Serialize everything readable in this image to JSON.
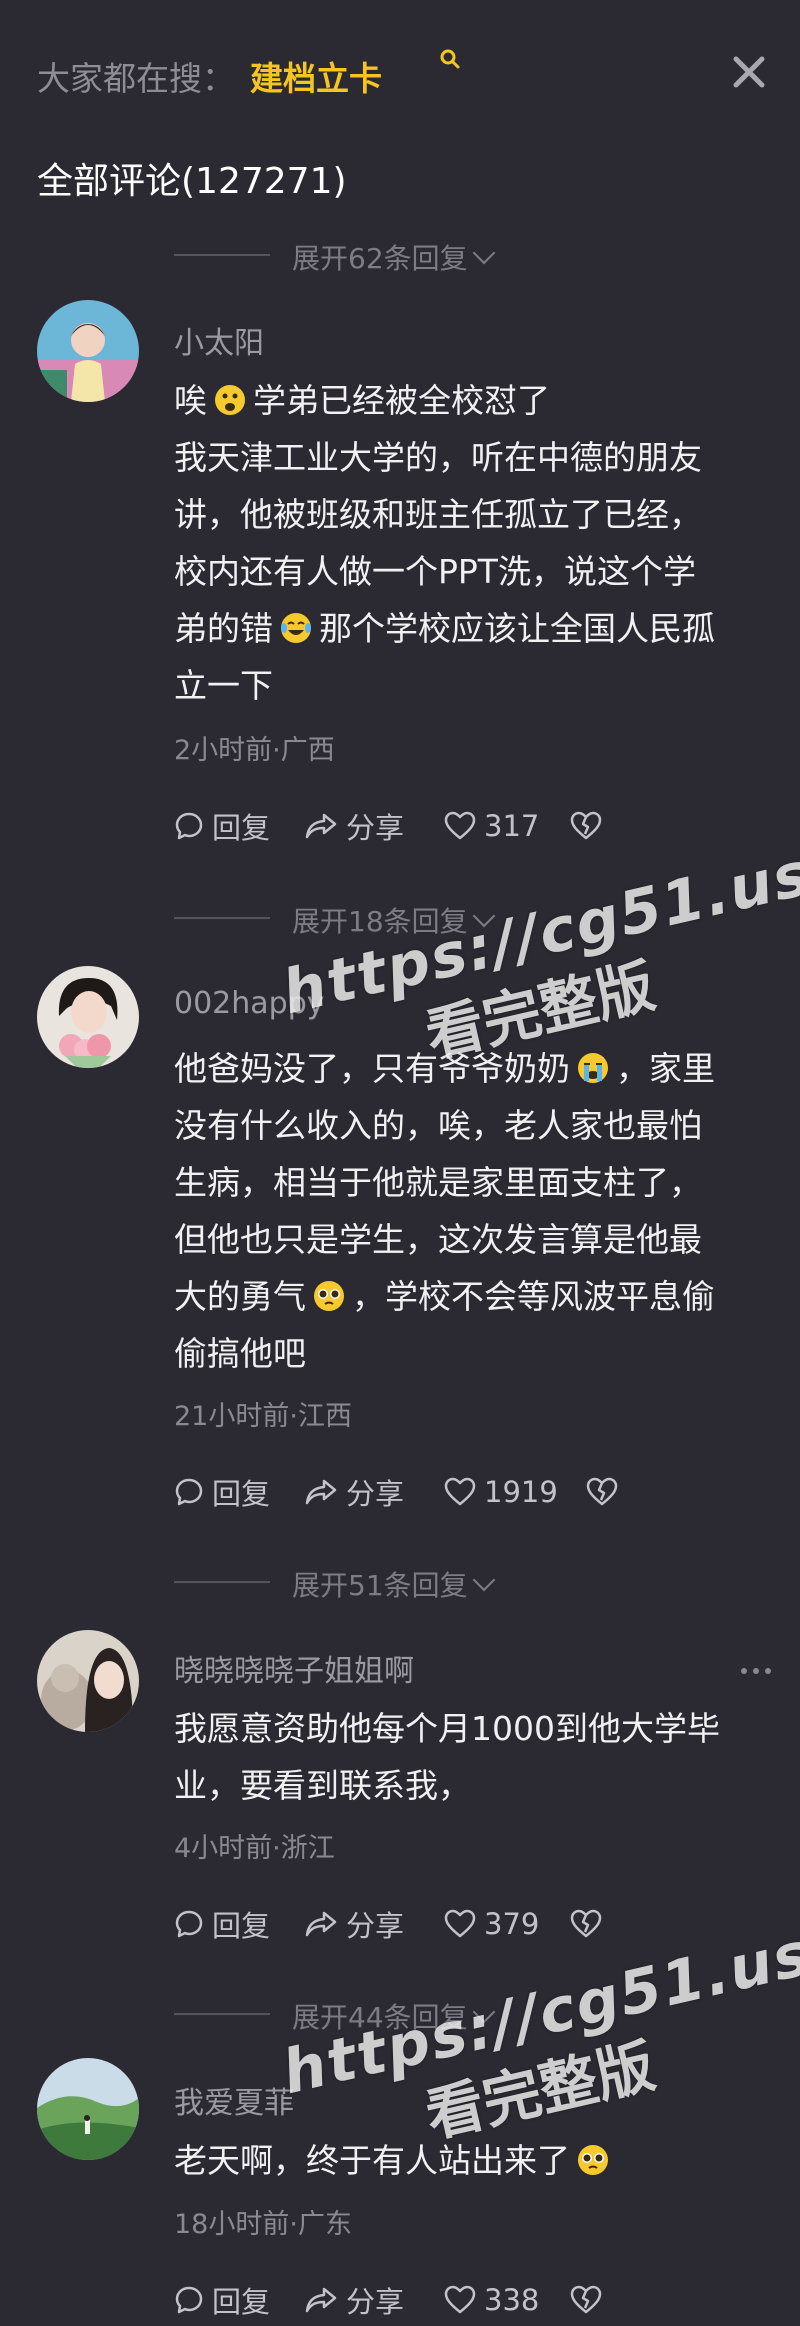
{
  "search": {
    "prefix": "大家都在搜：",
    "term": "建档立卡"
  },
  "comments_header": {
    "title": "全部评论(127271)"
  },
  "expand_labels": [
    "展开62条回复",
    "展开18条回复",
    "展开51条回复",
    "展开44条回复"
  ],
  "comments": [
    {
      "username": "小太阳",
      "lines": [
        {
          "text": "唉",
          "emoji": "scared-face-emoji",
          "after": "学弟已经被全校怼了"
        },
        {
          "text": "我天津工业大学的，听在中德的朋友"
        },
        {
          "text": "讲，他被班级和班主任孤立了已经，"
        },
        {
          "text": "校内还有人做一个PPT洗，说这个学"
        },
        {
          "text": "弟的错",
          "emoji": "crying-laughing-emoji",
          "after": "那个学校应该让全国人民孤"
        },
        {
          "text": "立一下"
        }
      ],
      "time_location": "2小时前·广西",
      "reply_label": "回复",
      "share_label": "分享",
      "likes": "317"
    },
    {
      "username": "002happy",
      "lines": [
        {
          "text": "他爸妈没了，只有爷爷奶奶",
          "emoji": "loudly-crying-emoji",
          "after": "，家里"
        },
        {
          "text": "没有什么收入的，唉，老人家也最怕"
        },
        {
          "text": "生病，相当于他就是家里面支柱了，"
        },
        {
          "text": "但他也只是学生，这次发言算是他最"
        },
        {
          "text": "大的勇气",
          "emoji": "pleading-face-emoji",
          "after": "，学校不会等风波平息偷"
        },
        {
          "text": "偷搞他吧"
        }
      ],
      "time_location": "21小时前·江西",
      "reply_label": "回复",
      "share_label": "分享",
      "likes": "1919"
    },
    {
      "username": "晓晓晓晓子姐姐啊",
      "lines": [
        {
          "text": "我愿意资助他每个月1000到他大学毕"
        },
        {
          "text": "业，要看到联系我，"
        }
      ],
      "time_location": "4小时前·浙江",
      "reply_label": "回复",
      "share_label": "分享",
      "likes": "379"
    },
    {
      "username": "我爱夏菲",
      "lines": [
        {
          "text": "老天啊，终于有人站出来了",
          "emoji": "pleading-face-emoji",
          "after": ""
        }
      ],
      "time_location": "18小时前·广东",
      "reply_label": "回复",
      "share_label": "分享",
      "likes": "338"
    }
  ],
  "watermark": {
    "line1": "https://cg51.us",
    "line2": "看完整版"
  },
  "colors": {
    "background": "#2b2a32",
    "search_term": "#f7c51f",
    "text": "#f1f1f3",
    "muted": "#8a8992"
  }
}
